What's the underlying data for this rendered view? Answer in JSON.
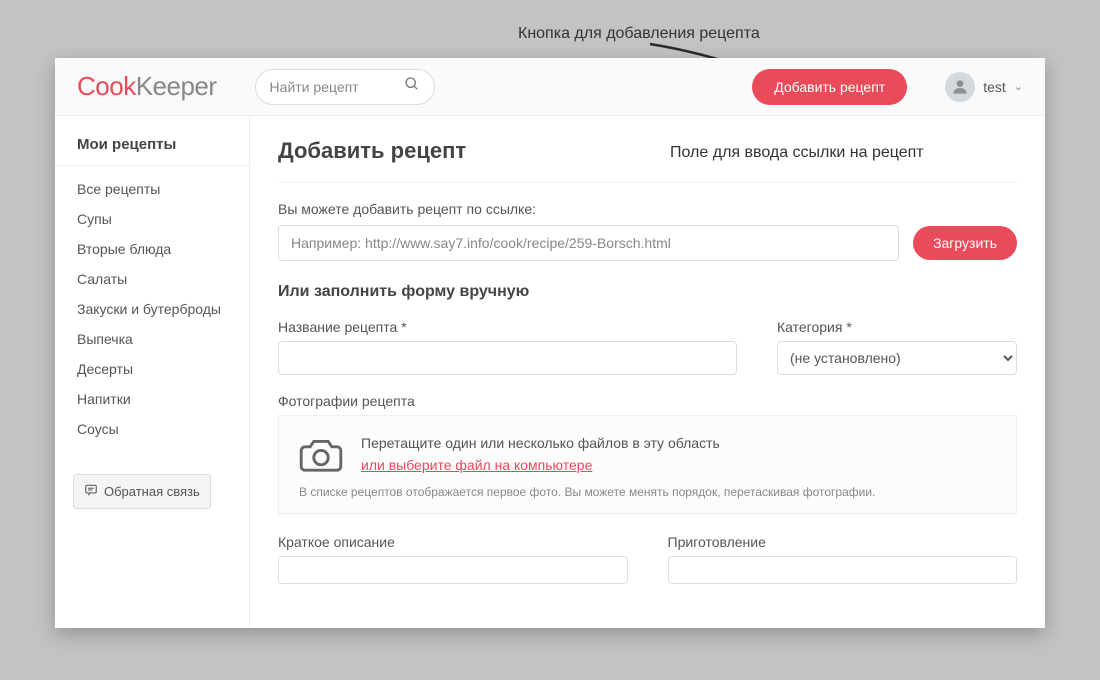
{
  "annotations": {
    "top": "Кнопка для добавления рецепта",
    "mid": "Поле для ввода ссылки на рецепт"
  },
  "header": {
    "logo_brand": "Cook",
    "logo_rest": "Keeper",
    "search_placeholder": "Найти рецепт",
    "add_recipe_label": "Добавить рецепт",
    "user_name": "test"
  },
  "sidebar": {
    "title": "Мои рецепты",
    "items": [
      "Все рецепты",
      "Супы",
      "Вторые блюда",
      "Салаты",
      "Закуски и бутерброды",
      "Выпечка",
      "Десерты",
      "Напитки",
      "Соусы"
    ],
    "feedback_label": "Обратная связь"
  },
  "main": {
    "title": "Добавить рецепт",
    "url_section_label": "Вы можете добавить рецепт по ссылке:",
    "url_placeholder": "Например: http://www.say7.info/cook/recipe/259-Borsch.html",
    "load_label": "Загрузить",
    "or_heading": "Или заполнить форму вручную",
    "name_label": "Название рецепта *",
    "category_label": "Категория *",
    "category_selected": "(не установлено)",
    "photos_label": "Фотографии рецепта",
    "drop_text": "Перетащите один или несколько файлов в эту область",
    "choose_link": "или выберите файл на компьютере",
    "photo_hint": "В списке рецептов отображается первое фото. Вы можете менять порядок, перетаскивая фотографии.",
    "short_desc_label": "Краткое описание",
    "preparation_label": "Приготовление"
  }
}
